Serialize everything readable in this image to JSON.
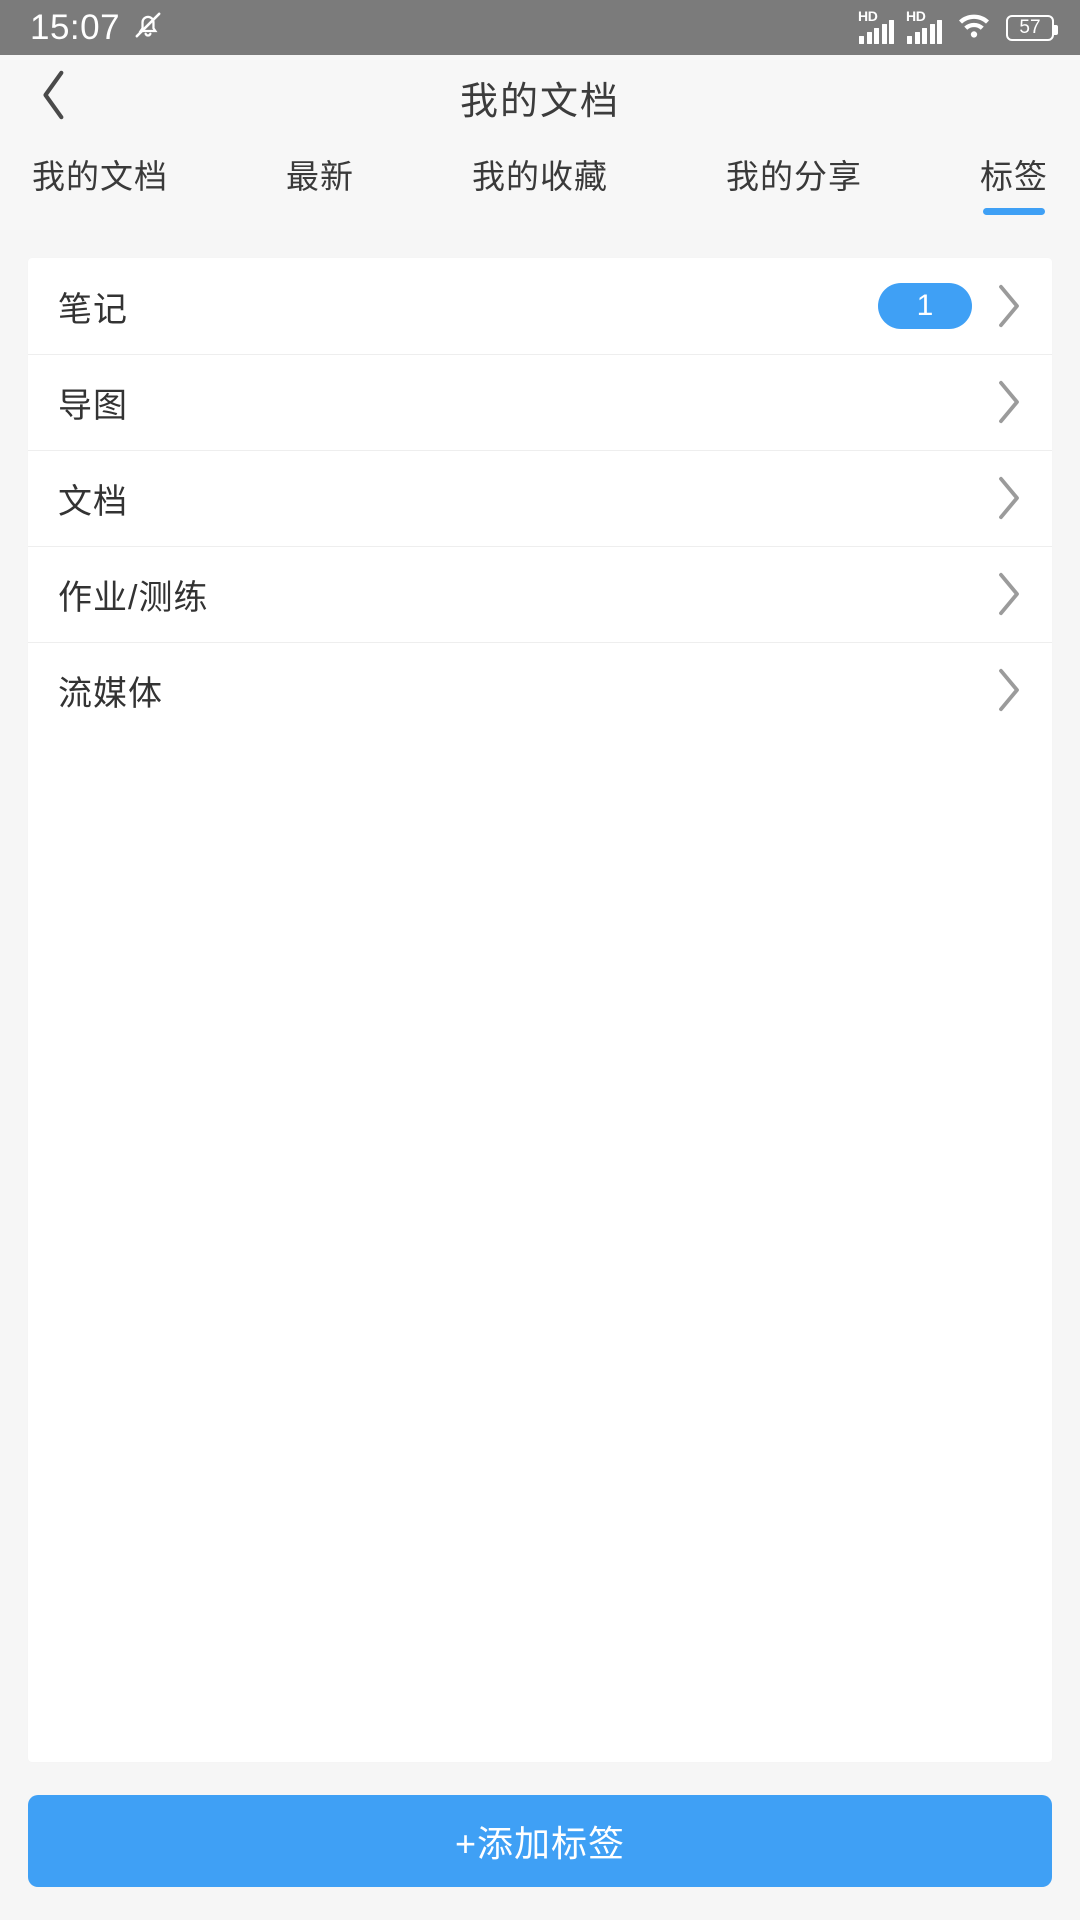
{
  "statusbar": {
    "time": "15:07",
    "mute_icon": "bell-muted-icon",
    "signal_1_label": "HD",
    "signal_2_label": "HD",
    "wifi_icon": "wifi-icon",
    "battery_level": "57"
  },
  "header": {
    "back_icon": "chevron-left-icon",
    "title": "我的文档"
  },
  "tabs": {
    "items": [
      {
        "label": "我的文档",
        "active": false
      },
      {
        "label": "最新",
        "active": false
      },
      {
        "label": "我的收藏",
        "active": false
      },
      {
        "label": "我的分享",
        "active": false
      },
      {
        "label": "标签",
        "active": true
      }
    ],
    "indicator_color": "#3fa0f5"
  },
  "list": {
    "rows": [
      {
        "label": "笔记",
        "badge": "1",
        "chevron_icon": "chevron-right-icon"
      },
      {
        "label": "导图",
        "badge": "",
        "chevron_icon": "chevron-right-icon"
      },
      {
        "label": "文档",
        "badge": "",
        "chevron_icon": "chevron-right-icon"
      },
      {
        "label": "作业/测练",
        "badge": "",
        "chevron_icon": "chevron-right-icon"
      },
      {
        "label": "流媒体",
        "badge": "",
        "chevron_icon": "chevron-right-icon"
      }
    ],
    "badge_color": "#3fa0f5"
  },
  "footer": {
    "add_label": "+添加标签",
    "button_color": "#3fa0f5"
  }
}
